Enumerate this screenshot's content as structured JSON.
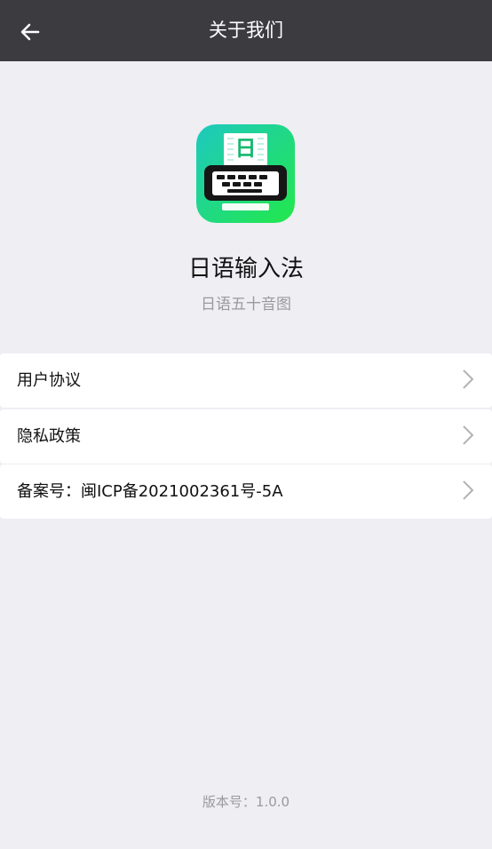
{
  "header": {
    "title": "关于我们",
    "back_icon": "arrow-left-icon"
  },
  "app": {
    "name": "日语输入法",
    "subtitle": "日语五十音图",
    "icon": "keyboard-app-icon",
    "icon_glyph": "日",
    "icon_colors": [
      "#1ec9c0",
      "#22e84a"
    ]
  },
  "menu": {
    "items": [
      {
        "label": "用户协议",
        "icon": "chevron-right-icon"
      },
      {
        "label": "隐私政策",
        "icon": "chevron-right-icon"
      },
      {
        "label": "备案号：闽ICP备2021002361号-5A",
        "icon": "chevron-right-icon"
      }
    ]
  },
  "footer": {
    "version": "版本号：1.0.0"
  },
  "colors": {
    "header_bg": "#3b3b40",
    "page_bg": "#efeef3",
    "text_secondary": "#9a9a9e"
  }
}
